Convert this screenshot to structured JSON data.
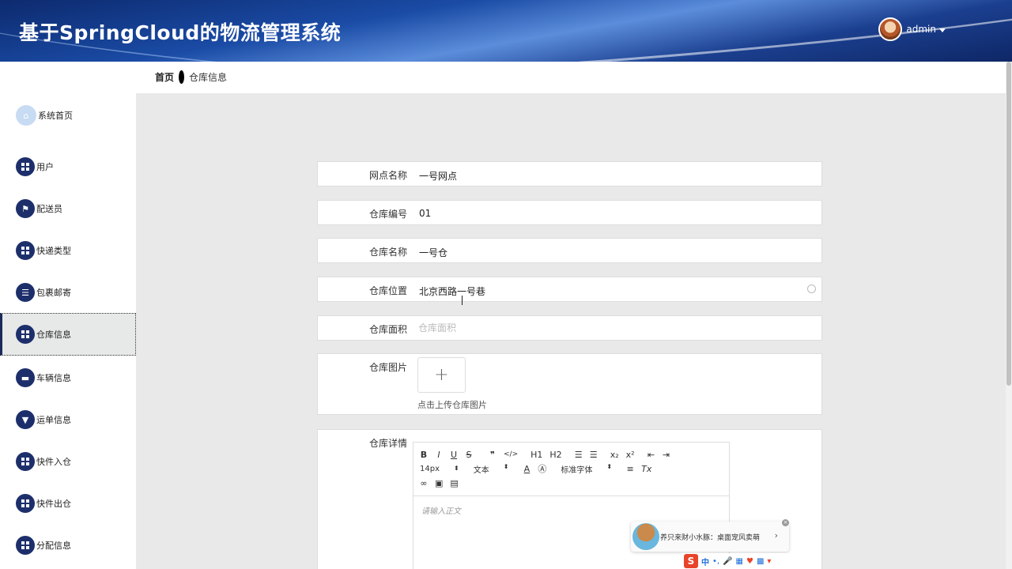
{
  "header": {
    "title": "基于SpringCloud的物流管理系统",
    "username": "admin"
  },
  "breadcrumb": {
    "home": "首页",
    "current": "仓库信息"
  },
  "sidebar": {
    "items": [
      {
        "label": "系统首页",
        "icon": "home-icon"
      },
      {
        "label": "用户",
        "icon": "grid-icon"
      },
      {
        "label": "配送员",
        "icon": "flag-icon"
      },
      {
        "label": "快递类型",
        "icon": "grid-icon"
      },
      {
        "label": "包裹邮寄",
        "icon": "list-icon"
      },
      {
        "label": "仓库信息",
        "icon": "grid-icon",
        "active": true
      },
      {
        "label": "车辆信息",
        "icon": "monitor-icon"
      },
      {
        "label": "运单信息",
        "icon": "pin-icon"
      },
      {
        "label": "快件入仓",
        "icon": "grid-icon"
      },
      {
        "label": "快件出仓",
        "icon": "grid-icon"
      },
      {
        "label": "分配信息",
        "icon": "grid-icon"
      }
    ]
  },
  "form": {
    "branch_name": {
      "label": "网点名称",
      "value": "一号网点"
    },
    "warehouse_no": {
      "label": "仓库编号",
      "value": "01"
    },
    "warehouse_name": {
      "label": "仓库名称",
      "value": "一号仓"
    },
    "location": {
      "label": "仓库位置",
      "value": "北京西路一号巷"
    },
    "area": {
      "label": "仓库面积",
      "placeholder": "仓库面积"
    },
    "image": {
      "label": "仓库图片",
      "upload_symbol": "+",
      "hint": "点击上传仓库图片"
    },
    "details": {
      "label": "仓库详情",
      "placeholder": "请输入正文"
    }
  },
  "editor": {
    "row1": [
      "B",
      "I",
      "U",
      "S",
      "❞",
      "</>",
      "H1",
      "H2",
      "☰",
      "☰",
      "x₂",
      "x²",
      "⇤",
      "⇥"
    ],
    "font_size": "14px",
    "text_type": "文本",
    "font_family": "标准字体"
  },
  "ime": {
    "notice": "养只来财小水豚：桌面宠风卖萌",
    "logo": "S",
    "mode": "中"
  }
}
